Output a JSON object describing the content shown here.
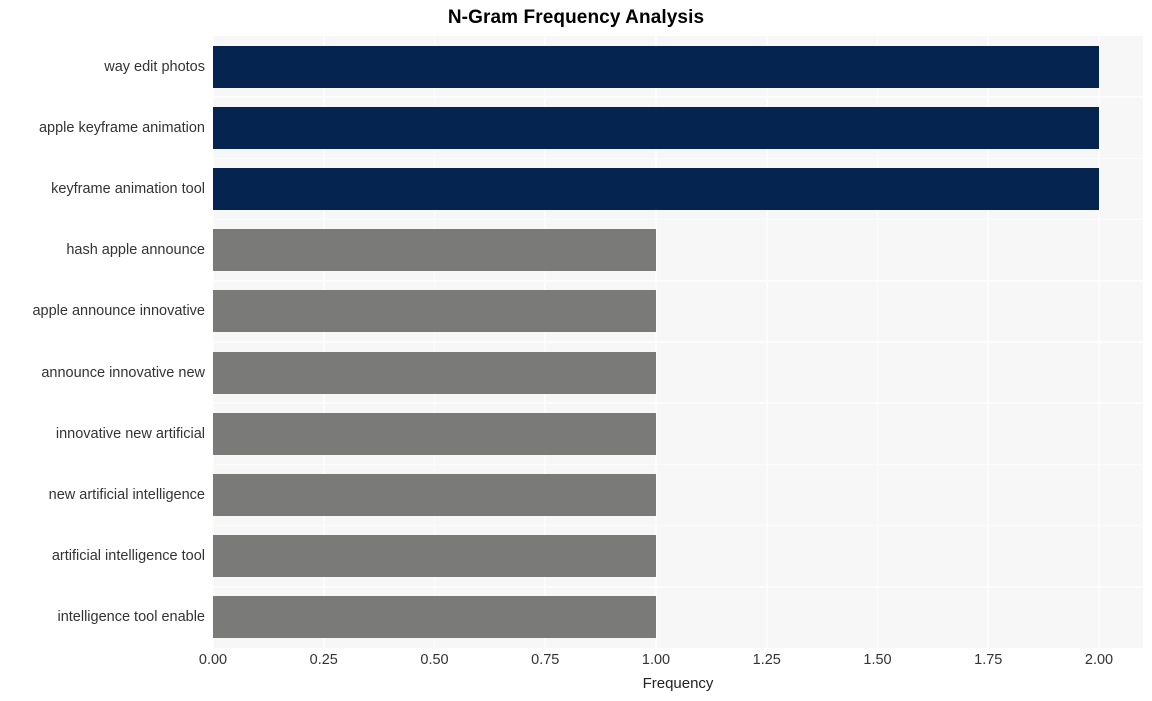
{
  "chart_data": {
    "type": "bar",
    "orientation": "horizontal",
    "title": "N-Gram Frequency Analysis",
    "xlabel": "Frequency",
    "ylabel": "",
    "xlim": [
      0,
      2
    ],
    "ylim": null,
    "grid": true,
    "legend": null,
    "xticks": [
      "0.00",
      "0.25",
      "0.50",
      "0.75",
      "1.00",
      "1.25",
      "1.50",
      "1.75",
      "2.00"
    ],
    "xtick_values": [
      0,
      0.25,
      0.5,
      0.75,
      1,
      1.25,
      1.5,
      1.75,
      2
    ],
    "categories": [
      "way edit photos",
      "apple keyframe animation",
      "keyframe animation tool",
      "hash apple announce",
      "apple announce innovative",
      "announce innovative new",
      "innovative new artificial",
      "new artificial intelligence",
      "artificial intelligence tool",
      "intelligence tool enable"
    ],
    "values": [
      2,
      2,
      2,
      1,
      1,
      1,
      1,
      1,
      1,
      1
    ],
    "bar_colors": [
      "#052450",
      "#052450",
      "#052450",
      "#7a7a78",
      "#7a7a78",
      "#7a7a78",
      "#7a7a78",
      "#7a7a78",
      "#7a7a78",
      "#7a7a78"
    ],
    "colors": {
      "high": "#052450",
      "low": "#7a7a78",
      "plot_background": "#f7f7f7",
      "figure_background": "#ffffff",
      "gridline": "#fcfcfd",
      "tick_label": "#333333",
      "title": "#000000"
    }
  }
}
